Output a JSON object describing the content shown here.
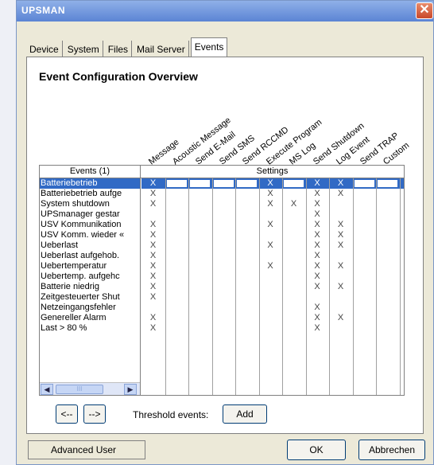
{
  "window": {
    "title": "UPSMAN"
  },
  "tabs": [
    {
      "label": "Device",
      "active": false
    },
    {
      "label": "System",
      "active": false
    },
    {
      "label": "Files",
      "active": false
    },
    {
      "label": "Mail Server",
      "active": false
    },
    {
      "label": "Events",
      "active": true
    }
  ],
  "panel": {
    "heading": "Event Configuration Overview"
  },
  "columns": [
    "Message",
    "Acoustic Message",
    "Send E-Mail",
    "Send SMS",
    "Send RCCMD",
    "Execute Program",
    "MS Log",
    "Send Shutdown",
    "Log Event",
    "Send TRAP",
    "Custom"
  ],
  "grid": {
    "events_header": "Events (1)",
    "settings_header": "Settings",
    "mark_char": "X",
    "rows": [
      {
        "label": "Batteriebetrieb",
        "selected": true,
        "marks": [
          1,
          0,
          0,
          0,
          0,
          1,
          0,
          1,
          1,
          0,
          0
        ]
      },
      {
        "label": "Batteriebetrieb aufge",
        "selected": false,
        "marks": [
          1,
          0,
          0,
          0,
          0,
          1,
          0,
          1,
          1,
          0,
          0
        ]
      },
      {
        "label": "System shutdown",
        "selected": false,
        "marks": [
          1,
          0,
          0,
          0,
          0,
          1,
          1,
          1,
          0,
          0,
          0
        ]
      },
      {
        "label": "UPSmanager gestar",
        "selected": false,
        "marks": [
          0,
          0,
          0,
          0,
          0,
          0,
          0,
          1,
          0,
          0,
          0
        ]
      },
      {
        "label": "USV Kommunikation",
        "selected": false,
        "marks": [
          1,
          0,
          0,
          0,
          0,
          1,
          0,
          1,
          1,
          0,
          0
        ]
      },
      {
        "label": "USV Komm. wieder «",
        "selected": false,
        "marks": [
          1,
          0,
          0,
          0,
          0,
          0,
          0,
          1,
          1,
          0,
          0
        ]
      },
      {
        "label": "Ueberlast",
        "selected": false,
        "marks": [
          1,
          0,
          0,
          0,
          0,
          1,
          0,
          1,
          1,
          0,
          0
        ]
      },
      {
        "label": "Ueberlast aufgehob.",
        "selected": false,
        "marks": [
          1,
          0,
          0,
          0,
          0,
          0,
          0,
          1,
          0,
          0,
          0
        ]
      },
      {
        "label": "Uebertemperatur",
        "selected": false,
        "marks": [
          1,
          0,
          0,
          0,
          0,
          1,
          0,
          1,
          1,
          0,
          0
        ]
      },
      {
        "label": "Uebertemp. aufgehc",
        "selected": false,
        "marks": [
          1,
          0,
          0,
          0,
          0,
          0,
          0,
          1,
          0,
          0,
          0
        ]
      },
      {
        "label": "Batterie niedrig",
        "selected": false,
        "marks": [
          1,
          0,
          0,
          0,
          0,
          0,
          0,
          1,
          1,
          0,
          0
        ]
      },
      {
        "label": "Zeitgesteuerter Shut",
        "selected": false,
        "marks": [
          1,
          0,
          0,
          0,
          0,
          0,
          0,
          0,
          0,
          0,
          0
        ]
      },
      {
        "label": "Netzeingangsfehler",
        "selected": false,
        "marks": [
          0,
          0,
          0,
          0,
          0,
          0,
          0,
          1,
          0,
          0,
          0
        ]
      },
      {
        "label": "Genereller Alarm",
        "selected": false,
        "marks": [
          1,
          0,
          0,
          0,
          0,
          0,
          0,
          1,
          1,
          0,
          0
        ]
      },
      {
        "label": "Last > 80 %",
        "selected": false,
        "marks": [
          1,
          0,
          0,
          0,
          0,
          0,
          0,
          1,
          0,
          0,
          0
        ]
      }
    ],
    "scroll_thumb_text": "III"
  },
  "nav": {
    "prev_label": "<--",
    "next_label": "-->"
  },
  "threshold": {
    "label": "Threshold events:",
    "add_label": "Add"
  },
  "status": {
    "user_label": "Advanced User"
  },
  "buttons": {
    "ok_label": "OK",
    "cancel_label": "Abbrechen"
  }
}
